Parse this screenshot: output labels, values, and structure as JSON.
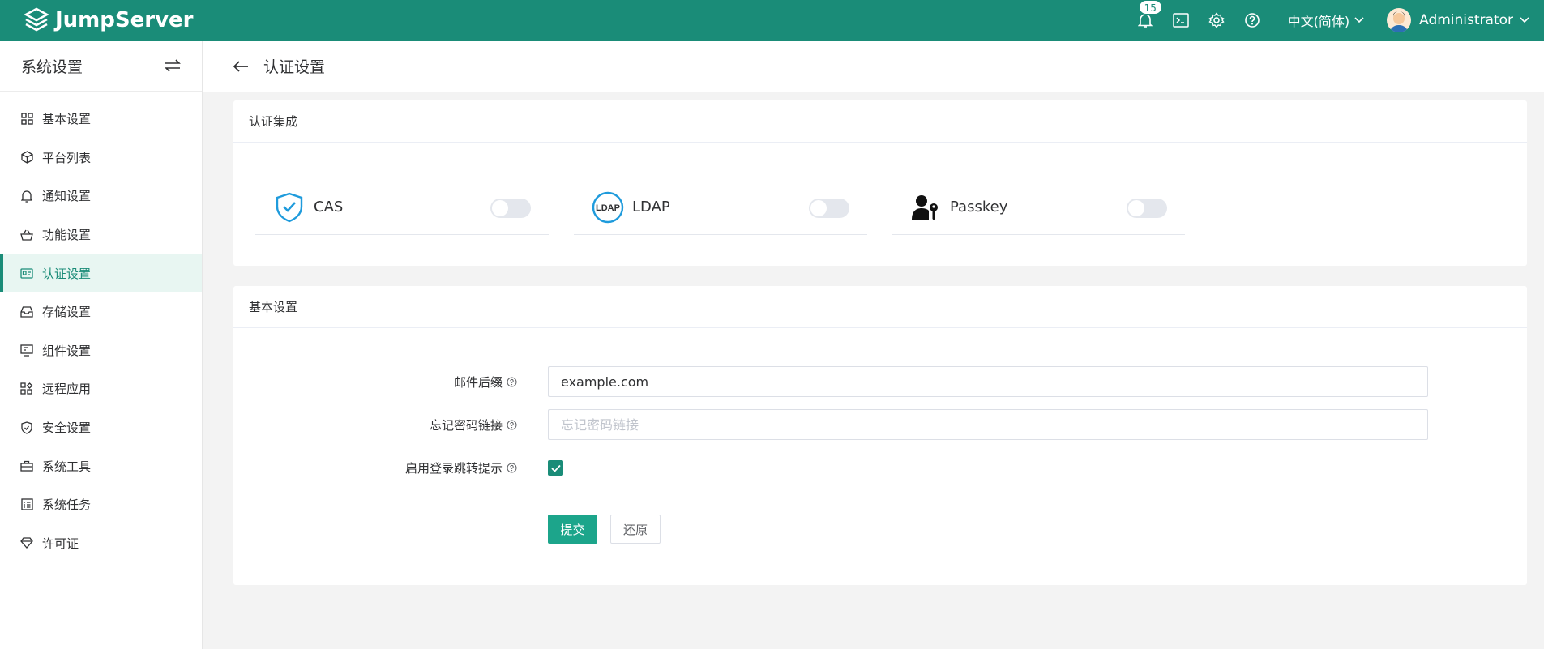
{
  "app": {
    "brand": "JumpServer"
  },
  "header": {
    "notifications_count": "15",
    "language": "中文(简体)",
    "user_name": "Administrator"
  },
  "sidebar": {
    "title": "系统设置",
    "items": [
      {
        "label": "基本设置",
        "icon": "grid-icon"
      },
      {
        "label": "平台列表",
        "icon": "cube-icon"
      },
      {
        "label": "通知设置",
        "icon": "bell-icon"
      },
      {
        "label": "功能设置",
        "icon": "basket-icon"
      },
      {
        "label": "认证设置",
        "icon": "id-card-icon",
        "active": true
      },
      {
        "label": "存储设置",
        "icon": "inbox-icon"
      },
      {
        "label": "组件设置",
        "icon": "monitor-icon"
      },
      {
        "label": "远程应用",
        "icon": "apps-icon"
      },
      {
        "label": "安全设置",
        "icon": "shield-icon"
      },
      {
        "label": "系统工具",
        "icon": "briefcase-icon"
      },
      {
        "label": "系统任务",
        "icon": "tasks-icon"
      },
      {
        "label": "许可证",
        "icon": "diamond-icon"
      }
    ]
  },
  "page": {
    "title": "认证设置"
  },
  "integration": {
    "title": "认证集成",
    "items": [
      {
        "label": "CAS",
        "icon": "shield-check-icon",
        "enabled": false
      },
      {
        "label": "LDAP",
        "icon": "ldap-icon",
        "icon_text": "LDAP",
        "enabled": false
      },
      {
        "label": "Passkey",
        "icon": "user-key-icon",
        "enabled": false
      }
    ]
  },
  "basic": {
    "title": "基本设置",
    "email_suffix_label": "邮件后缀",
    "email_suffix_value": "example.com",
    "forgot_pwd_label": "忘记密码链接",
    "forgot_pwd_placeholder": "忘记密码链接",
    "login_redirect_label": "启用登录跳转提示",
    "login_redirect_checked": true,
    "submit_label": "提交",
    "reset_label": "还原"
  },
  "colors": {
    "primary": "#1a8c78",
    "button": "#1ca58b",
    "cas_blue": "#1f9bdc"
  }
}
